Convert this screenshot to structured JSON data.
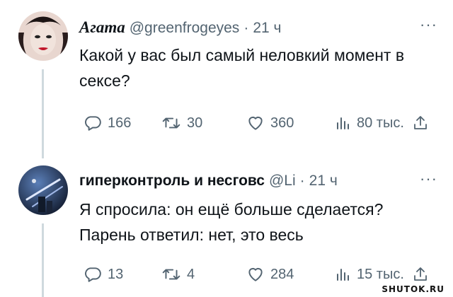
{
  "tweets": [
    {
      "name": "Агата",
      "handle": "@greenfrogeyes",
      "separator": "·",
      "time": "21 ч",
      "more": "···",
      "text": "Какой у вас был самый неловкий момент в сексе?",
      "replies": "166",
      "retweets": "30",
      "likes": "360",
      "views": "80 тыс."
    },
    {
      "name": "гиперконтроль и несговс",
      "handle": "@Li",
      "separator": "·",
      "time": "21 ч",
      "more": "···",
      "text_line1": "Я спросила: он ещё больше сделается?",
      "text_line2": "Парень ответил: нет, это весь",
      "replies": "13",
      "retweets": "4",
      "likes": "284",
      "views": "15 тыс."
    }
  ],
  "watermark": "SHUTOK.RU",
  "icons": [
    "reply-icon",
    "retweet-icon",
    "like-icon",
    "views-icon",
    "share-icon"
  ]
}
